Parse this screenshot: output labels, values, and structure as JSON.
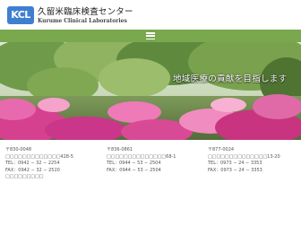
{
  "header": {
    "logo_mark": "KCL",
    "name_jp": "久留米臨床検査センター",
    "name_en": "Kurume Clinical Laboratories"
  },
  "nav": {
    "menu_icon": "hamburger-icon",
    "accent": "#7aa84e"
  },
  "hero": {
    "tagline": "地域医療の貢献を目指します"
  },
  "offices": [
    {
      "postal": "〒830-0048",
      "address": "□□□□□□□□□□□□□428-5",
      "tel": "TEL：0942 − 32 − 2254",
      "fax": "FAX：0942 − 32 − 2520",
      "extra": "□□□□□□□□□"
    },
    {
      "postal": "〒836-0861",
      "address": "□□□□□□□□□□□□□□68-1",
      "tel": "TEL：0944 − 53 − 2504",
      "fax": "FAX：0944 − 53 − 2504",
      "extra": ""
    },
    {
      "postal": "〒877-0024",
      "address": "□□□□□□□□□□□□□□13-20",
      "tel": "TEL：0973 − 24 − 3353",
      "fax": "FAX：0973 − 24 − 3353",
      "extra": ""
    }
  ]
}
